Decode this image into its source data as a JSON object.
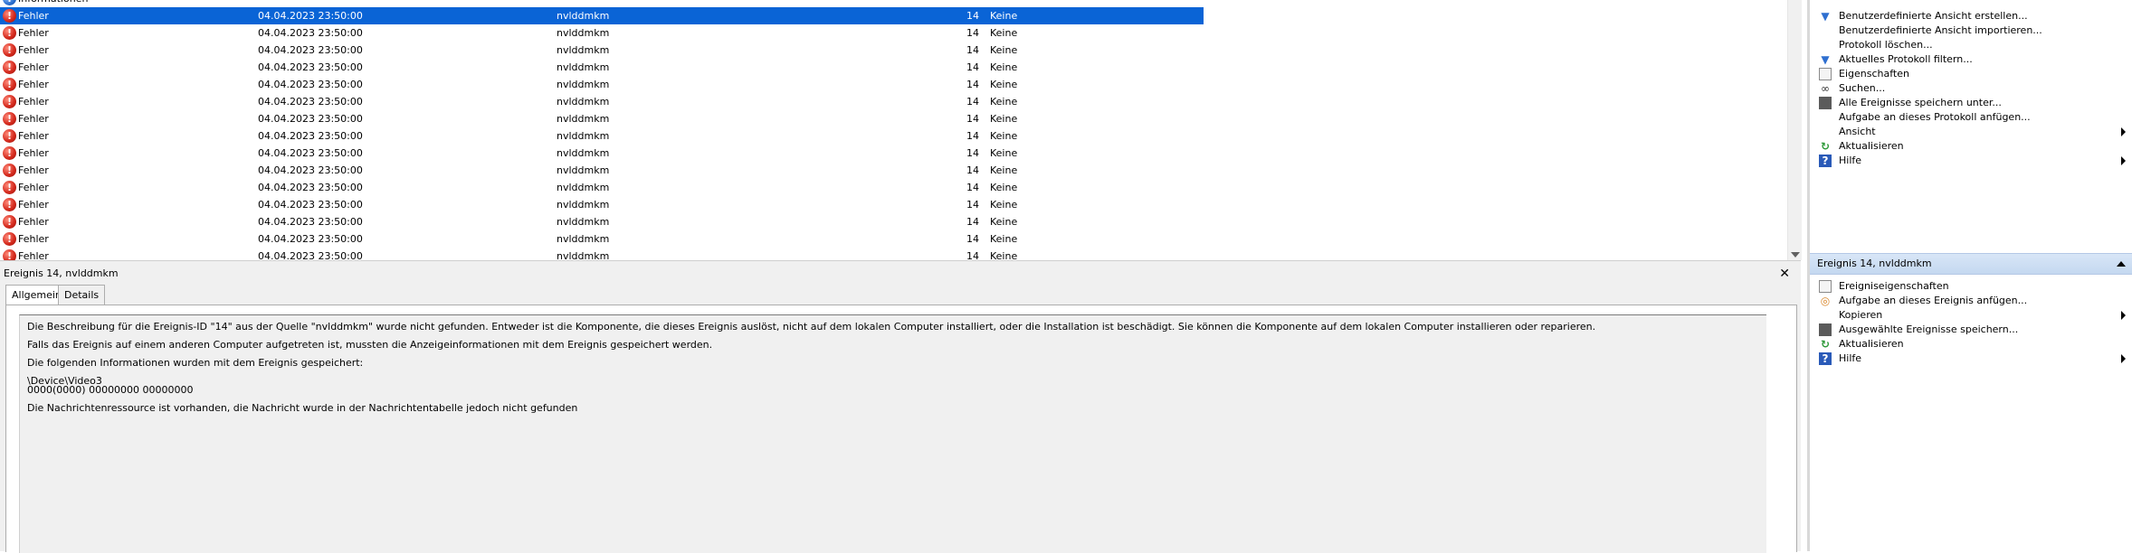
{
  "event_list": {
    "partial_top_row": {
      "level": "Informationen",
      "date": "",
      "source": "",
      "id": "",
      "category": ""
    },
    "rows": [
      {
        "level": "Fehler",
        "date": "04.04.2023 23:50:00",
        "source": "nvlddmkm",
        "id": "14",
        "category": "Keine",
        "selected": true
      },
      {
        "level": "Fehler",
        "date": "04.04.2023 23:50:00",
        "source": "nvlddmkm",
        "id": "14",
        "category": "Keine"
      },
      {
        "level": "Fehler",
        "date": "04.04.2023 23:50:00",
        "source": "nvlddmkm",
        "id": "14",
        "category": "Keine"
      },
      {
        "level": "Fehler",
        "date": "04.04.2023 23:50:00",
        "source": "nvlddmkm",
        "id": "14",
        "category": "Keine"
      },
      {
        "level": "Fehler",
        "date": "04.04.2023 23:50:00",
        "source": "nvlddmkm",
        "id": "14",
        "category": "Keine"
      },
      {
        "level": "Fehler",
        "date": "04.04.2023 23:50:00",
        "source": "nvlddmkm",
        "id": "14",
        "category": "Keine"
      },
      {
        "level": "Fehler",
        "date": "04.04.2023 23:50:00",
        "source": "nvlddmkm",
        "id": "14",
        "category": "Keine"
      },
      {
        "level": "Fehler",
        "date": "04.04.2023 23:50:00",
        "source": "nvlddmkm",
        "id": "14",
        "category": "Keine"
      },
      {
        "level": "Fehler",
        "date": "04.04.2023 23:50:00",
        "source": "nvlddmkm",
        "id": "14",
        "category": "Keine"
      },
      {
        "level": "Fehler",
        "date": "04.04.2023 23:50:00",
        "source": "nvlddmkm",
        "id": "14",
        "category": "Keine"
      },
      {
        "level": "Fehler",
        "date": "04.04.2023 23:50:00",
        "source": "nvlddmkm",
        "id": "14",
        "category": "Keine"
      },
      {
        "level": "Fehler",
        "date": "04.04.2023 23:50:00",
        "source": "nvlddmkm",
        "id": "14",
        "category": "Keine"
      },
      {
        "level": "Fehler",
        "date": "04.04.2023 23:50:00",
        "source": "nvlddmkm",
        "id": "14",
        "category": "Keine"
      },
      {
        "level": "Fehler",
        "date": "04.04.2023 23:50:00",
        "source": "nvlddmkm",
        "id": "14",
        "category": "Keine"
      },
      {
        "level": "Fehler",
        "date": "04.04.2023 23:50:00",
        "source": "nvlddmkm",
        "id": "14",
        "category": "Keine"
      }
    ]
  },
  "detail": {
    "title": "Ereignis 14, nvlddmkm",
    "close_glyph": "✕",
    "tabs": [
      "Allgemein",
      "Details"
    ],
    "description": [
      "Die Beschreibung für die Ereignis-ID \"14\" aus der Quelle \"nvlddmkm\" wurde nicht gefunden. Entweder ist die Komponente, die dieses Ereignis auslöst, nicht auf dem lokalen Computer installiert, oder die Installation ist beschädigt. Sie können die Komponente auf dem lokalen Computer installieren oder reparieren.",
      "Falls das Ereignis auf einem anderen Computer aufgetreten ist, mussten die Anzeigeinformationen mit dem Ereignis gespeichert werden.",
      "Die folgenden Informationen wurden mit dem Ereignis gespeichert:",
      "\\Device\\Video3",
      "0000(0000) 00000000 00000000",
      "Die Nachrichtenressource ist vorhanden, die Nachricht wurde in der Nachrichtentabelle jedoch nicht gefunden"
    ]
  },
  "actions": {
    "log_items": [
      {
        "label": "Benutzerdefinierte Ansicht erstellen...",
        "icon": "filter-create-icon"
      },
      {
        "label": "Benutzerdefinierte Ansicht importieren...",
        "icon": ""
      },
      {
        "label": "Protokoll löschen...",
        "icon": ""
      },
      {
        "label": "Aktuelles Protokoll filtern...",
        "icon": "filter-icon"
      },
      {
        "label": "Eigenschaften",
        "icon": "properties-icon"
      },
      {
        "label": "Suchen...",
        "icon": "binoculars-icon"
      },
      {
        "label": "Alle Ereignisse speichern unter...",
        "icon": "save-icon"
      },
      {
        "label": "Aufgabe an dieses Protokoll anfügen...",
        "icon": ""
      },
      {
        "label": "Ansicht",
        "icon": "",
        "submenu": true
      },
      {
        "label": "Aktualisieren",
        "icon": "refresh-icon"
      },
      {
        "label": "Hilfe",
        "icon": "help-icon",
        "submenu": true
      }
    ],
    "event_section_title": "Ereignis 14, nvlddmkm",
    "event_items": [
      {
        "label": "Ereigniseigenschaften",
        "icon": "properties-icon"
      },
      {
        "label": "Aufgabe an dieses Ereignis anfügen...",
        "icon": "task-icon"
      },
      {
        "label": "Kopieren",
        "icon": "",
        "submenu": true
      },
      {
        "label": "Ausgewählte Ereignisse speichern...",
        "icon": "save-icon"
      },
      {
        "label": "Aktualisieren",
        "icon": "refresh-icon"
      },
      {
        "label": "Hilfe",
        "icon": "help-icon",
        "submenu": true
      }
    ]
  }
}
